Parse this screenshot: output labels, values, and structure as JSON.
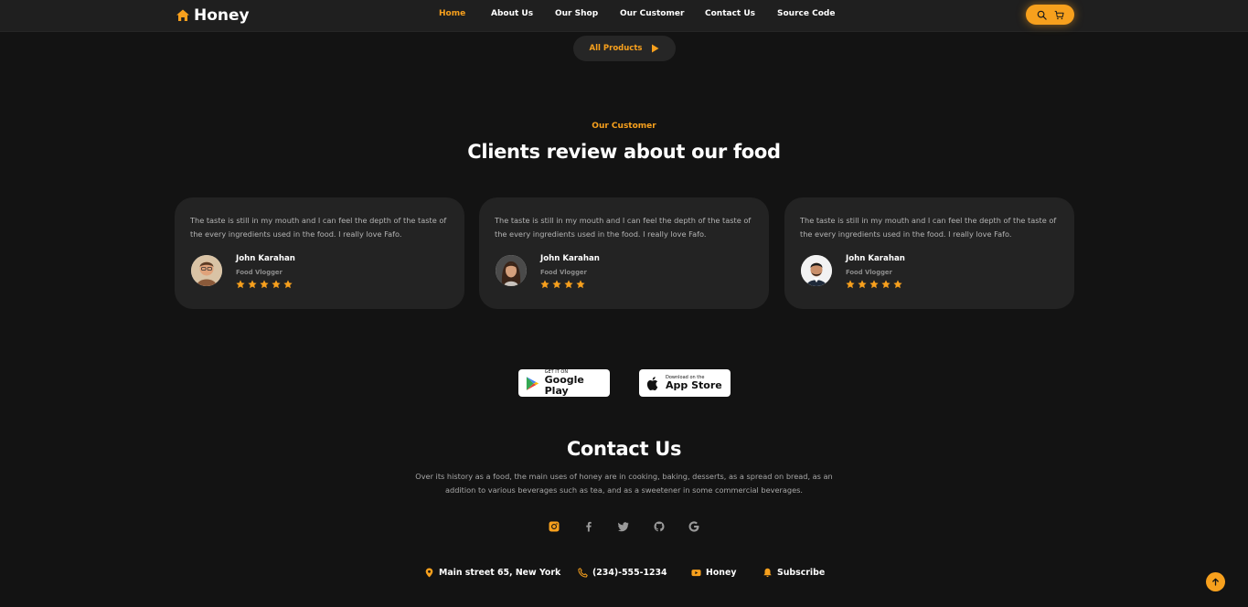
{
  "brand": {
    "name": "Honey",
    "accent": "#f7a01d"
  },
  "nav": {
    "items": [
      {
        "label": "Home",
        "active": true
      },
      {
        "label": "About Us",
        "active": false
      },
      {
        "label": "Our Shop",
        "active": false
      },
      {
        "label": "Our Customer",
        "active": false
      },
      {
        "label": "Contact Us",
        "active": false
      },
      {
        "label": "Source Code",
        "active": false
      }
    ],
    "actions": [
      "search-icon",
      "cart-icon"
    ]
  },
  "all_products": {
    "label": "All Products",
    "icon": "play-icon"
  },
  "reviews": {
    "kicker": "Our Customer",
    "title": "Clients review about our food",
    "cards": [
      {
        "text": "The taste is still in my mouth and I can feel the depth of the taste of the every ingredients used in the food. I really love Fafo.",
        "name": "John Karahan",
        "role": "Food Vlogger",
        "rating": 5
      },
      {
        "text": "The taste is still in my mouth and I can feel the depth of the taste of the every ingredients used in the food. I really love Fafo.",
        "name": "John Karahan",
        "role": "Food Vlogger",
        "rating": 4
      },
      {
        "text": "The taste is still in my mouth and I can feel the depth of the taste of the every ingredients used in the food. I really love Fafo.",
        "name": "John Karahan",
        "role": "Food Vlogger",
        "rating": 5
      }
    ]
  },
  "stores": {
    "google": {
      "small": "GET IT ON",
      "big": "Google Play"
    },
    "apple": {
      "small": "Download on the",
      "big": "App Store"
    }
  },
  "contact": {
    "title": "Contact Us",
    "description": "Over its history as a food, the main uses of honey are in cooking, baking, desserts, as a spread on bread, as an addition to various beverages such as tea, and as a sweetener in some commercial beverages.",
    "socials": [
      "instagram-icon",
      "facebook-icon",
      "twitter-icon",
      "github-icon",
      "google-icon"
    ],
    "info": {
      "address": "Main street 65, New York",
      "phone": "(234)-555-1234",
      "youtube": "Honey",
      "subscribe": "Subscribe"
    }
  }
}
